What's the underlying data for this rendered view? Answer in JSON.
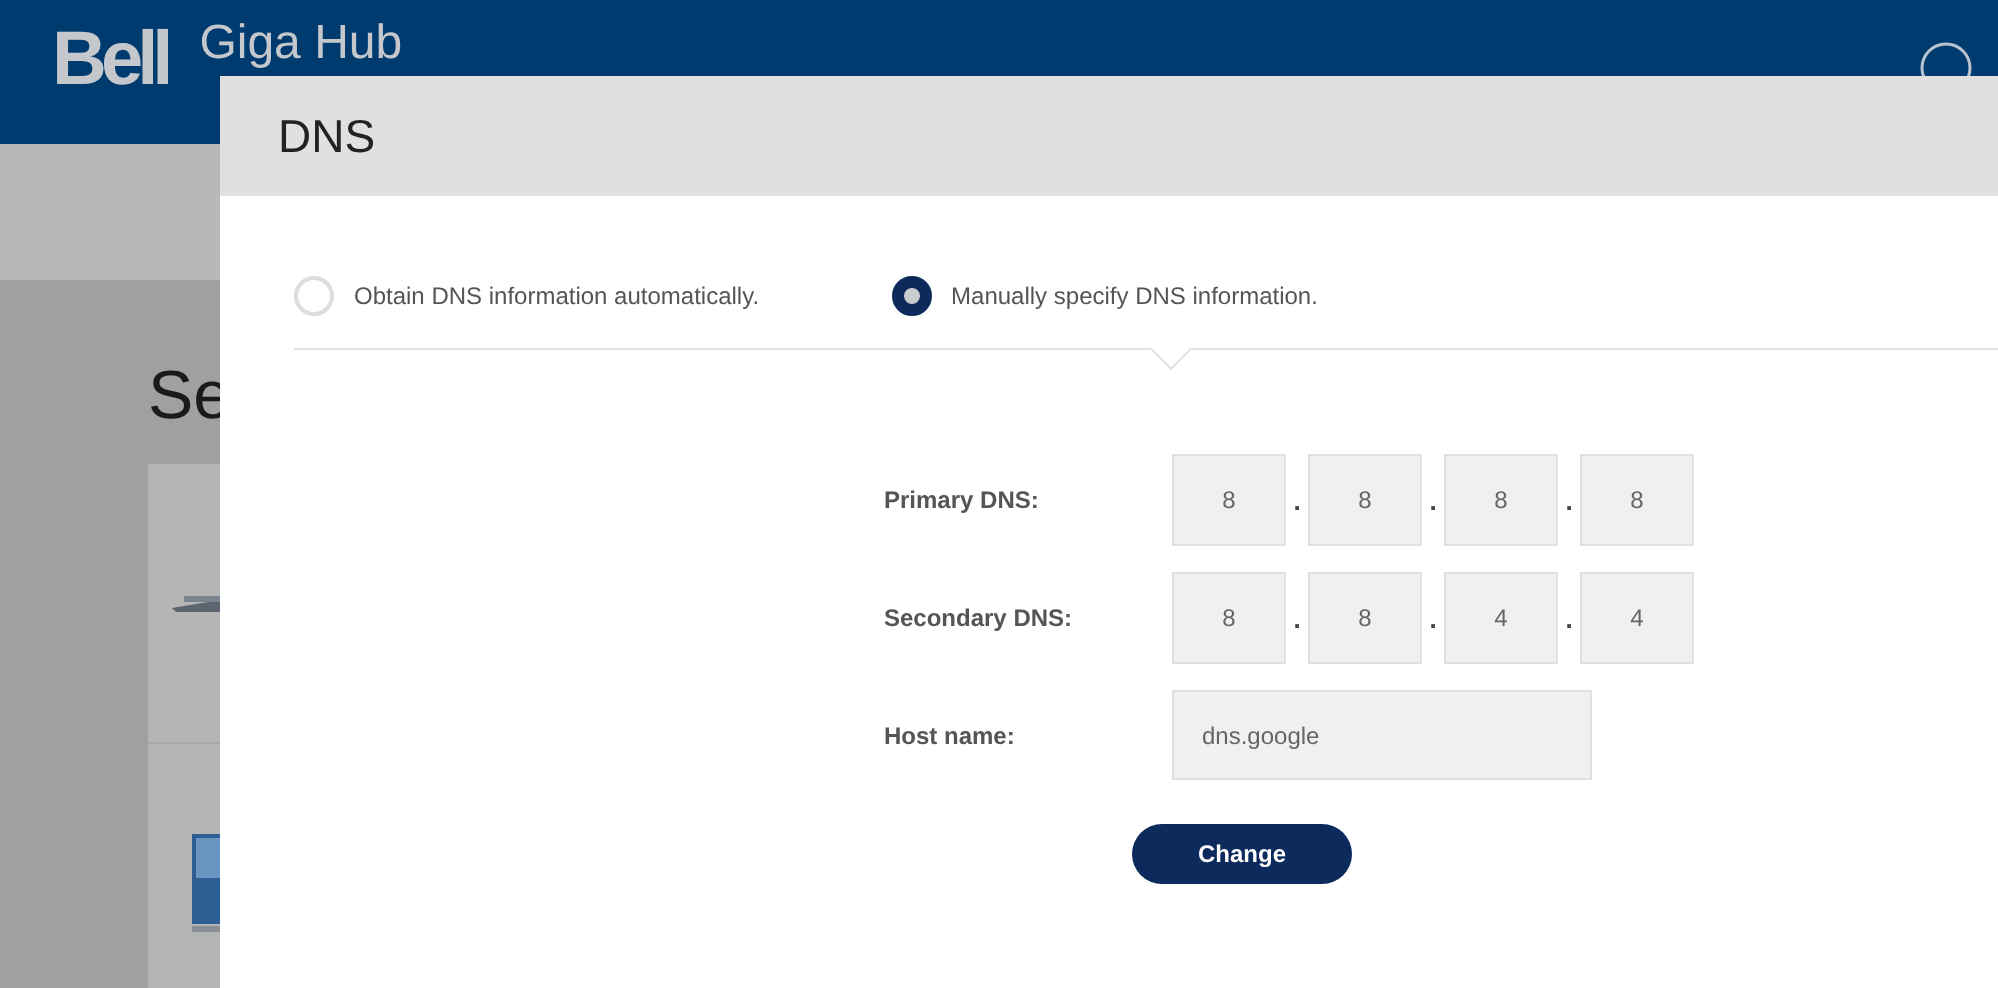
{
  "header": {
    "logo": "Bell",
    "product": "Giga Hub"
  },
  "page": {
    "heading": "Se"
  },
  "dialog": {
    "title": "DNS",
    "options": [
      {
        "label": "Obtain DNS information automatically.",
        "selected": false
      },
      {
        "label": "Manually specify DNS information.",
        "selected": true
      }
    ],
    "fields": [
      {
        "kind": "ip",
        "label": "Primary DNS:",
        "octets": [
          "8",
          "8",
          "8",
          "8"
        ],
        "separator": "."
      },
      {
        "kind": "ip",
        "label": "Secondary DNS:",
        "octets": [
          "8",
          "8",
          "4",
          "4"
        ],
        "separator": "."
      },
      {
        "kind": "text",
        "label": "Host name:",
        "value": "dns.google"
      }
    ],
    "button": "Change"
  }
}
